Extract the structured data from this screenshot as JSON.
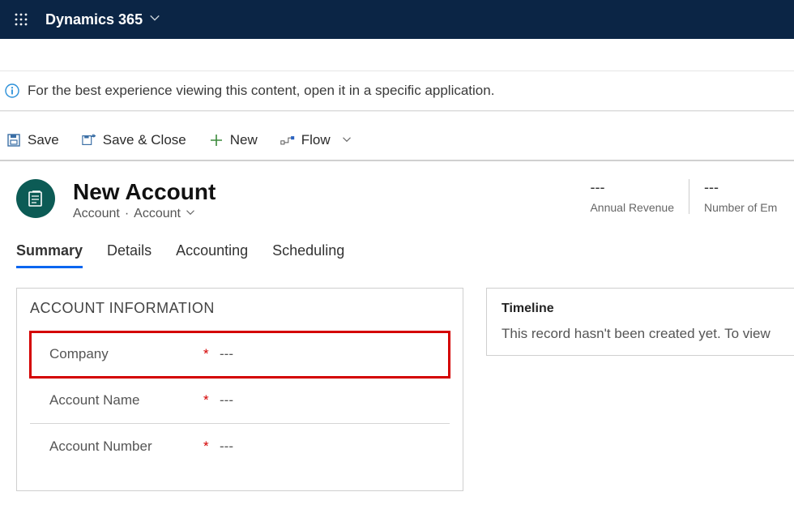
{
  "topnav": {
    "brand": "Dynamics 365"
  },
  "notification": {
    "text": "For the best experience viewing this content, open it in a specific application."
  },
  "commands": {
    "save": "Save",
    "save_close": "Save & Close",
    "new": "New",
    "flow": "Flow"
  },
  "record": {
    "title": "New Account",
    "entity": "Account",
    "form": "Account"
  },
  "headerFields": [
    {
      "value": "---",
      "label": "Annual Revenue"
    },
    {
      "value": "---",
      "label": "Number of Em"
    }
  ],
  "tabs": [
    "Summary",
    "Details",
    "Accounting",
    "Scheduling"
  ],
  "activeTab": "Summary",
  "section": {
    "title": "ACCOUNT INFORMATION",
    "fields": [
      {
        "label": "Company",
        "required": "*",
        "value": "---",
        "highlight": true
      },
      {
        "label": "Account Name",
        "required": "*",
        "value": "---",
        "highlight": false
      },
      {
        "label": "Account Number",
        "required": "*",
        "value": "---",
        "highlight": false
      }
    ]
  },
  "timeline": {
    "title": "Timeline",
    "message": "This record hasn't been created yet.  To view "
  }
}
